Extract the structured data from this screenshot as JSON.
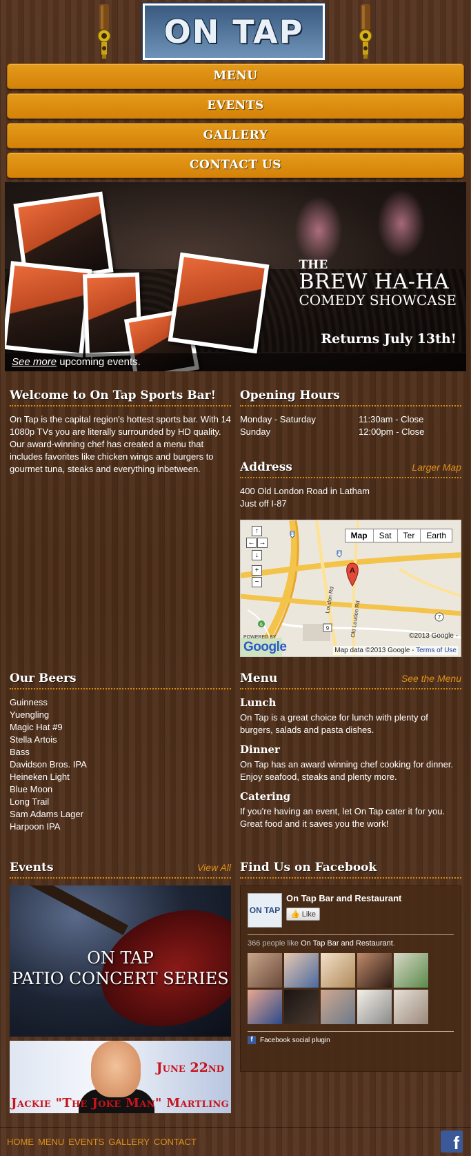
{
  "header": {
    "logo_text": "ON TAP"
  },
  "nav": {
    "items": [
      "MENU",
      "EVENTS",
      "GALLERY",
      "CONTACT US"
    ]
  },
  "hero": {
    "the": "THE",
    "title": "BREW HA-HA",
    "subtitle": "COMEDY SHOWCASE",
    "returns": "Returns July 13th!",
    "see_more": "See more",
    "caption_rest": " upcoming events."
  },
  "welcome": {
    "title": "Welcome to On Tap Sports Bar!",
    "text": "On Tap is the capital region's hottest sports bar. With 14 1080p TVs you are literally surrounded by HD quality. Our award-winning chef has created a menu that includes favorites like chicken wings and burgers to gourmet tuna, steaks and everything inbetween."
  },
  "hours": {
    "title": "Opening Hours",
    "rows": [
      {
        "day": "Monday - Saturday",
        "time": "11:30am - Close"
      },
      {
        "day": "Sunday",
        "time": "12:00pm - Close"
      }
    ]
  },
  "address": {
    "title": "Address",
    "link": "Larger Map",
    "line1": "400 Old London Road in Latham",
    "line2": "Just off I-87"
  },
  "map": {
    "types": [
      "Map",
      "Sat",
      "Ter",
      "Earth"
    ],
    "copyright": "©2013 Google -",
    "data_text": "Map data ©2013 Google - ",
    "terms": "Terms of Use",
    "powered_by": "POWERED BY",
    "google": "Google",
    "labels": {
      "road1": "Loudon Rd",
      "road2": "Old Loudon Rd",
      "marker": "A",
      "i87": "87",
      "r7": "7",
      "r6": "6",
      "r9": "9"
    }
  },
  "beers": {
    "title": "Our Beers",
    "items": [
      "Guinness",
      "Yuengling",
      "Magic Hat #9",
      "Stella Artois",
      "Bass",
      "Davidson Bros. IPA",
      "Heineken Light",
      "Blue Moon",
      "Long Trail",
      "Sam Adams Lager",
      "Harpoon IPA"
    ]
  },
  "menu": {
    "title": "Menu",
    "link": "See the Menu",
    "sections": [
      {
        "heading": "Lunch",
        "text": "On Tap is a great choice for lunch with plenty of burgers, salads and pasta dishes."
      },
      {
        "heading": "Dinner",
        "text": "On Tap has an award winning chef cooking for dinner. Enjoy seafood, steaks and plenty more."
      },
      {
        "heading": "Catering",
        "text": "If you're having an event, let On Tap cater it for you. Great food and it saves you the work!"
      }
    ]
  },
  "events": {
    "title": "Events",
    "link": "View All",
    "event1_line1": "ON TAP",
    "event1_line2": "PATIO CONCERT SERIES",
    "event2_date": "June 22nd",
    "event2_name": "Jackie \"The Joke Man\" Martling"
  },
  "facebook": {
    "title": "Find Us on Facebook",
    "page_name": "On Tap Bar and Restaurant",
    "logo_text": "ON TAP",
    "like": "Like",
    "count_text": "366 people like ",
    "count_page": "On Tap Bar and Restaurant",
    "count_end": ".",
    "plugin": "Facebook social plugin",
    "fb_letter": "f"
  },
  "footer": {
    "links": [
      "HOME",
      "MENU",
      "EVENTS",
      "GALLERY",
      "CONTACT"
    ],
    "fb_letter": "f"
  },
  "colors": {
    "accent": "#e0901a",
    "button": "#e49a1a",
    "background": "#4a2d18",
    "facebook": "#3b5998"
  }
}
